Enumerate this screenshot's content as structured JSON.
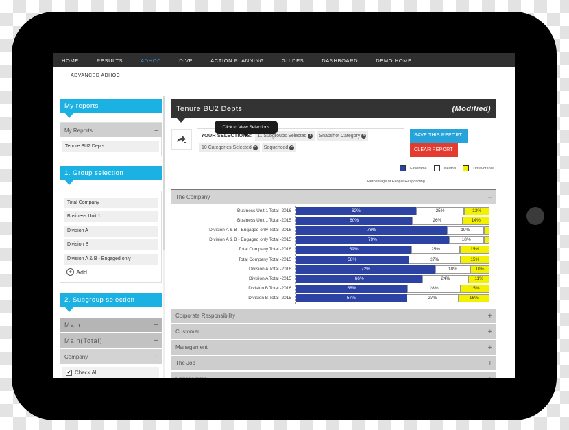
{
  "colors": {
    "nav_bg": "#2f2f2f",
    "nav_active": "#3d92d4",
    "panel_header": "#1cb1e3",
    "save_button": "#27a3db",
    "clear_button": "#e33b30",
    "favorable": "#2c43a3",
    "neutral": "#ffffff",
    "unfavorable": "#f3f000"
  },
  "nav": {
    "items": [
      {
        "label": "HOME",
        "active": false
      },
      {
        "label": "RESULTS",
        "active": false
      },
      {
        "label": "ADHOC",
        "active": true
      },
      {
        "label": "DIVE",
        "active": false
      },
      {
        "label": "ACTION PLANNING",
        "active": false
      },
      {
        "label": "GUIDES",
        "active": false
      },
      {
        "label": "DASHBOARD",
        "active": false
      },
      {
        "label": "DEMO HOME",
        "active": false
      }
    ],
    "subheader": "ADVANCED ADHOC"
  },
  "sidebar": {
    "my_reports": {
      "title": "My reports",
      "group_label": "My Reports",
      "collapse_symbol": "–",
      "items": [
        "Tenure BU2 Depts"
      ]
    },
    "group_selection": {
      "title": "1. Group selection",
      "items": [
        "Total Company",
        "Business Unit 1",
        "Division A",
        "Division B",
        "Division A & B - Engaged only"
      ],
      "add_label": "Add",
      "add_symbol": "+"
    },
    "subgroup_selection": {
      "title": "2. Subgroup selection",
      "rows": [
        {
          "label": "Main",
          "symbol": "–"
        },
        {
          "label": "Main(Total)",
          "symbol": "–"
        },
        {
          "label": "Company",
          "symbol": "–"
        }
      ],
      "check_all_label": "Check All",
      "check_all_checked": true,
      "check_mark": "✔"
    }
  },
  "report": {
    "title": "Tenure BU2 Depts",
    "status": "(Modified)",
    "selections_label": "YOUR SELECTIONS:",
    "tags": [
      "11 Subgroups Selected",
      "Snapshot Category",
      "10 Categories Selected",
      "Sequenced"
    ],
    "tag_close_symbol": "×",
    "tooltip": "Click to View Selections",
    "save_label": "SAVE THIS REPORT",
    "clear_label": "CLEAR REPORT"
  },
  "legend": [
    {
      "label": "Favorable",
      "color": "#2c43a3"
    },
    {
      "label": "Neutral",
      "color": "#ffffff"
    },
    {
      "label": "Unfavorable",
      "color": "#f3f000"
    }
  ],
  "caption": "Percentage of People Responding",
  "sections": [
    {
      "title": "The Company",
      "expanded": true,
      "symbol": "–"
    },
    {
      "title": "Corporate Responsibility",
      "expanded": false,
      "symbol": "+"
    },
    {
      "title": "Customer",
      "expanded": false,
      "symbol": "+"
    },
    {
      "title": "Management",
      "expanded": false,
      "symbol": "+"
    },
    {
      "title": "The Job",
      "expanded": false,
      "symbol": "+"
    },
    {
      "title": "Engagement",
      "expanded": false,
      "symbol": "+"
    }
  ],
  "chart_data": {
    "type": "bar",
    "orientation": "horizontal",
    "stacked": true,
    "title": "The Company",
    "xlabel": "Percentage of People Responding",
    "ylabel": "",
    "xlim": [
      0,
      100
    ],
    "legend": "top-right",
    "grid": false,
    "categories": [
      "Business Unit 1 Total -2016",
      "Business Unit 1 Total -2015",
      "Division A & B - Engaged only Total -2016",
      "Division A & B - Engaged only Total -2015",
      "Total Company Total -2016",
      "Total Company Total -2015",
      "Division A Total -2016",
      "Division A Total -2015",
      "Division B Total -2016",
      "Division B Total -2015"
    ],
    "series": [
      {
        "name": "Favorable",
        "values": [
          62,
          60,
          78,
          79,
          59,
          58,
          72,
          66,
          58,
          57
        ],
        "labels": [
          "62%",
          "60%",
          "78%",
          "79%",
          "59%",
          "58%",
          "72%",
          "66%",
          "58%",
          "57%"
        ]
      },
      {
        "name": "Neutral",
        "values": [
          25,
          26,
          19,
          18,
          25,
          27,
          18,
          24,
          28,
          27
        ],
        "labels": [
          "25%",
          "26%",
          "19%",
          "18%",
          "25%",
          "27%",
          "18%",
          "24%",
          "28%",
          "27%"
        ]
      },
      {
        "name": "Unfavorable",
        "values": [
          13,
          14,
          3,
          3,
          15,
          15,
          10,
          11,
          15,
          16
        ],
        "labels": [
          "13%",
          "14%",
          "",
          "",
          "15%",
          "15%",
          "10%",
          "11%",
          "15%",
          "16%"
        ]
      }
    ]
  }
}
